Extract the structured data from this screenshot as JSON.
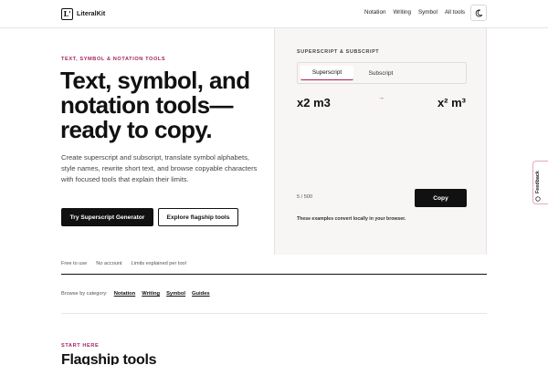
{
  "header": {
    "logo_mark": "L'",
    "logo_text": "LiteralKit",
    "nav": [
      "Notation",
      "Writing",
      "Symbol",
      "All tools"
    ],
    "theme_icon": "moon-icon"
  },
  "hero": {
    "eyebrow": "TEXT, SYMBOL & NOTATION TOOLS",
    "title_lines": [
      "Text, symbol, and",
      "notation tools—",
      "ready to copy."
    ],
    "description": "Create superscript and subscript, translate symbol alphabets, style names, rewrite short text, and browse copyable characters with focused tools that explain their limits.",
    "primary_cta": "Try Superscript Generator",
    "secondary_cta": "Explore flagship tools"
  },
  "demo": {
    "label": "SUPERSCRIPT & SUBSCRIPT",
    "tabs": [
      "Superscript",
      "Subscript"
    ],
    "active_tab": "Superscript",
    "input": "x2 m3",
    "arrow": "→",
    "output": "x² m³",
    "counter": "5 / 500",
    "copy_label": "Copy",
    "note": "These examples convert locally in your browser."
  },
  "feedback": {
    "label": "Feedback",
    "icon": "chat-bubble-icon"
  },
  "trust": [
    "Free to use",
    "No account",
    "Limits explained per tool"
  ],
  "categories": {
    "label": "Browse by category:",
    "items": [
      "Notation",
      "Writing",
      "Symbol",
      "Guides"
    ]
  },
  "flagship": {
    "eyebrow": "START HERE",
    "title": "Flagship tools"
  },
  "colors": {
    "accent": "#a3245f",
    "dark": "#111111",
    "panel": "#f8f5f5"
  }
}
